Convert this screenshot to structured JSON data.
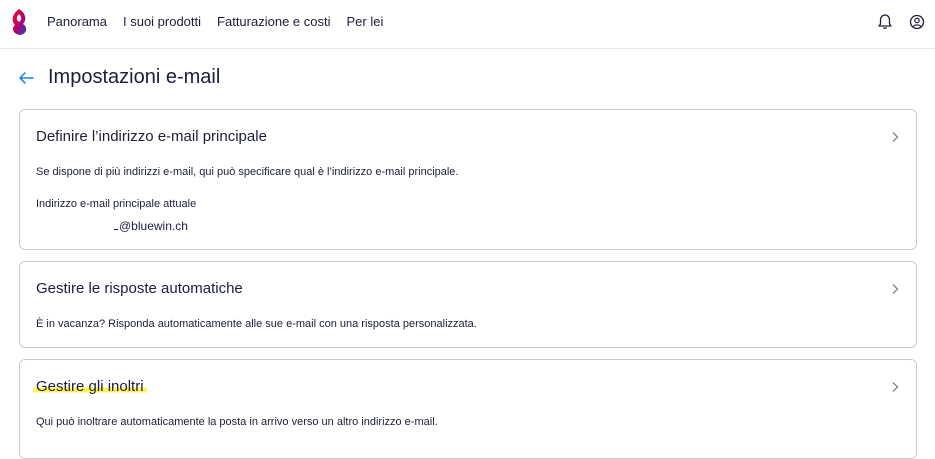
{
  "nav": {
    "items": [
      "Panorama",
      "I suoi prodotti",
      "Fatturazione e costi",
      "Per lei"
    ]
  },
  "icons": {
    "logo": "swisscom-logo-icon",
    "bell": "bell-icon",
    "user": "user-icon",
    "back": "arrow-left-icon",
    "chevron": "chevron-right-icon"
  },
  "page": {
    "title": "Impostazioni e-mail"
  },
  "cards": {
    "primary": {
      "title": "Definire l’indirizzo e-mail principale",
      "description": "Se dispone di più indirizzi e-mail, qui può specificare qual è l’indirizzo e-mail principale.",
      "label": "Indirizzo e-mail principale attuale",
      "value": "@bluewin.ch"
    },
    "autoreply": {
      "title": "Gestire le risposte automatiche",
      "description": "È in vacanza? Risponda automaticamente alle sue e-mail con una risposta personalizzata."
    },
    "forwarding": {
      "title": "Gestire gli inoltri",
      "description": "Qui può inoltrare automaticamente la posta in arrivo verso un altro indirizzo e-mail."
    }
  },
  "colors": {
    "text": "#1b1e3c",
    "accent": "#1781e3",
    "border": "#c9ccd3",
    "highlight": "#fff35c"
  }
}
